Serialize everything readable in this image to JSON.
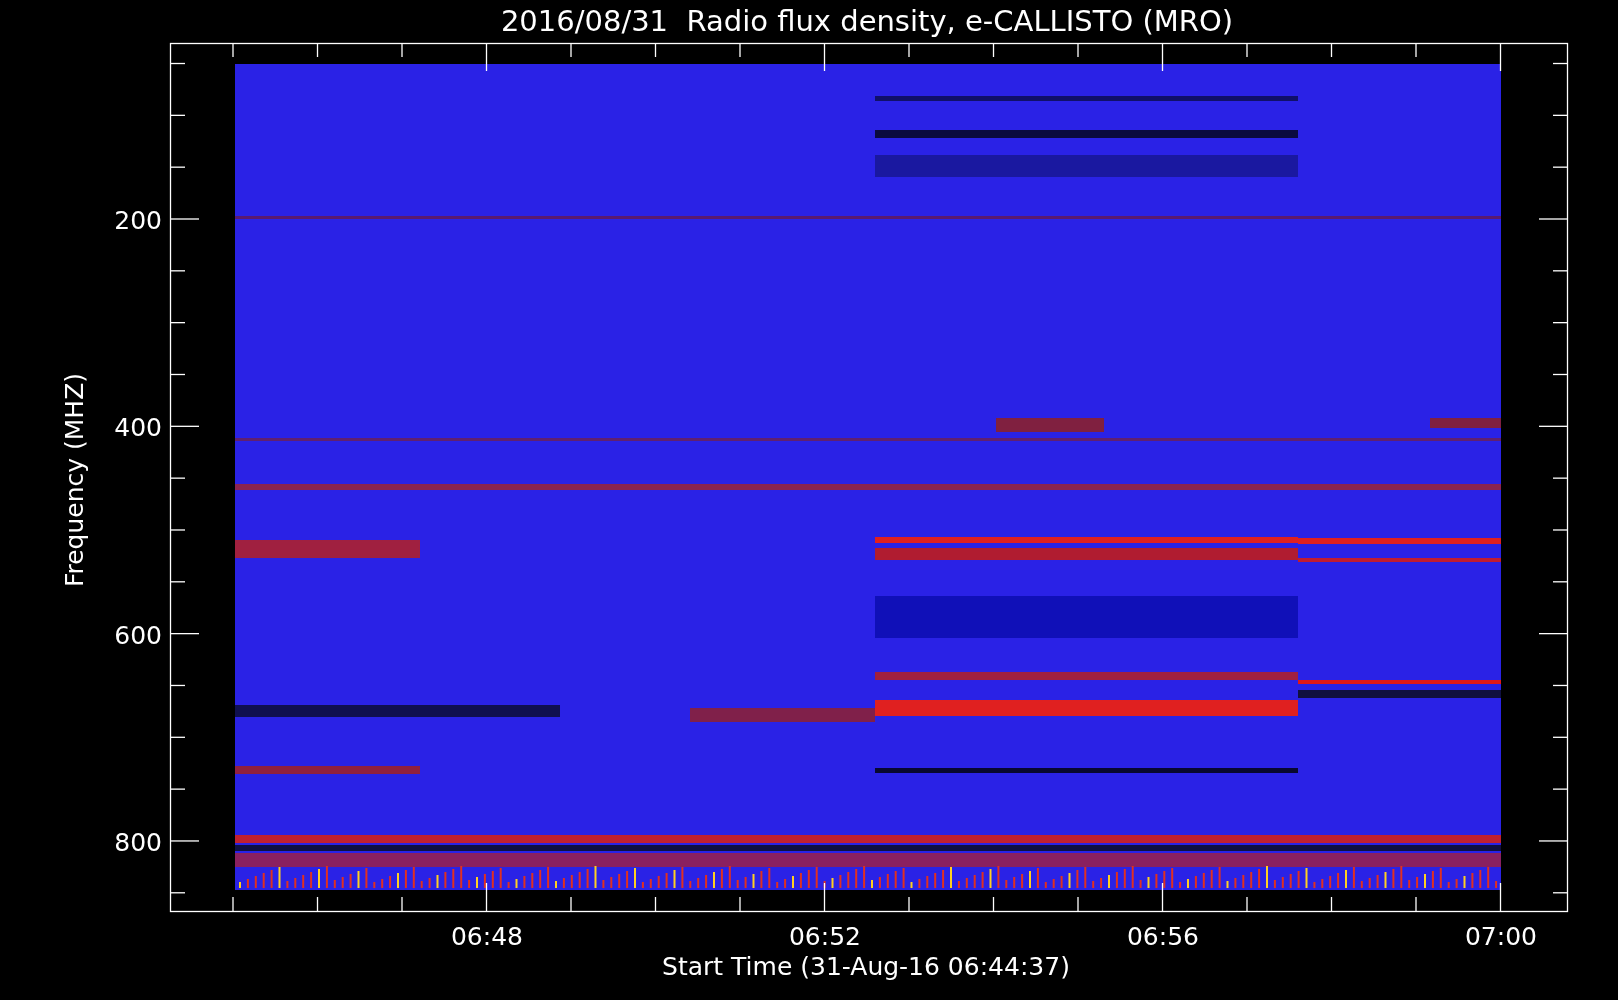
{
  "plot": {
    "title": "2016/08/31  Radio flux density, e-CALLISTO (MRO)",
    "ylabel": "Frequency (MHZ)",
    "xlabel": "Start Time (31-Aug-16 06:44:37)",
    "ytick_labels": [
      "200",
      "400",
      "600",
      "800"
    ],
    "xtick_labels": [
      "06:48",
      "06:52",
      "06:56",
      "07:00"
    ]
  }
}
